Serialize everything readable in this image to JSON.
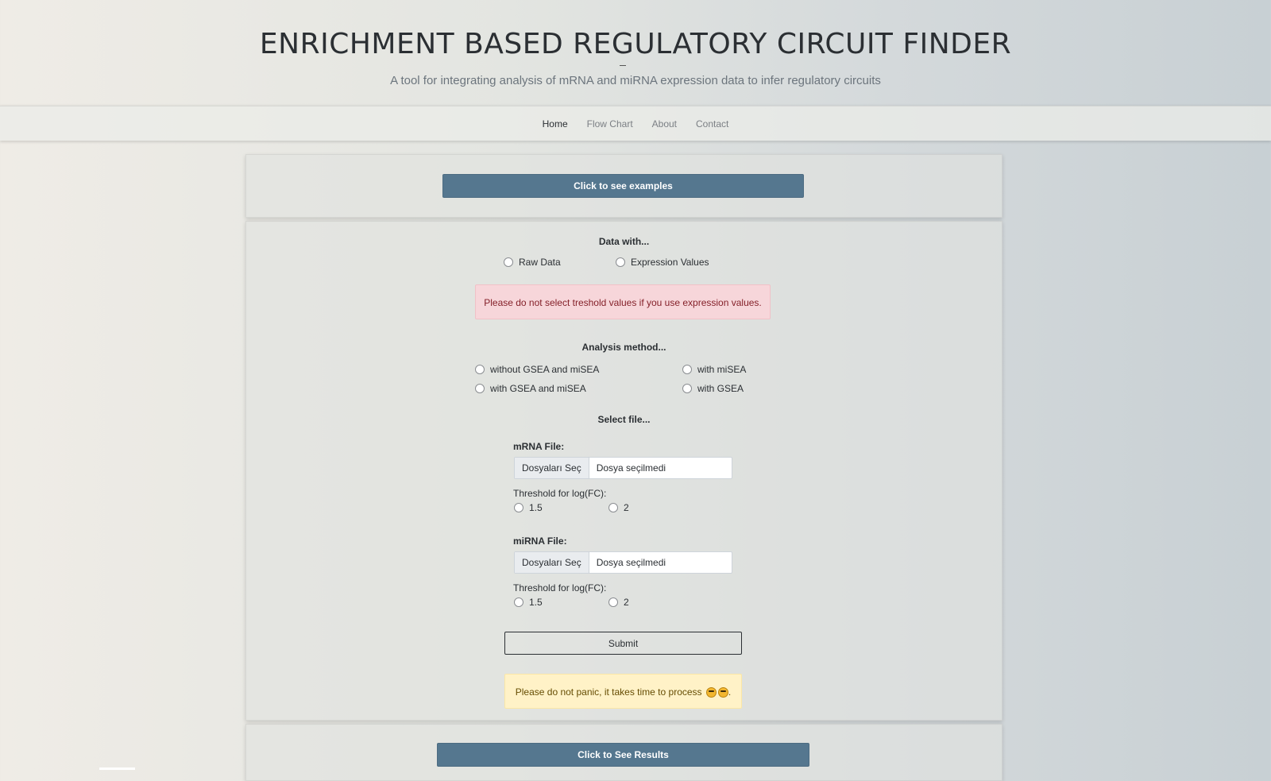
{
  "header": {
    "title": "ENRICHMENT BASED REGULATORY CIRCUIT FINDER",
    "subtitle": "A tool for integrating analysis of mRNA and miRNA expression data to infer regulatory circuits"
  },
  "nav": {
    "items": [
      {
        "label": "Home",
        "active": true
      },
      {
        "label": "Flow Chart",
        "active": false
      },
      {
        "label": "About",
        "active": false
      },
      {
        "label": "Contact",
        "active": false
      }
    ]
  },
  "examples": {
    "button_label": "Click to see examples"
  },
  "form": {
    "data_with": {
      "label": "Data with...",
      "options": [
        "Raw Data",
        "Expression Values"
      ]
    },
    "threshold_warning": "Please do not select treshold values if you use expression values.",
    "analysis": {
      "label": "Analysis method...",
      "options": [
        "without GSEA and miSEA",
        "with miSEA",
        "with GSEA and miSEA",
        "with GSEA"
      ]
    },
    "select_file_label": "Select file...",
    "mrna": {
      "label": "mRNA File:",
      "button": "Dosyaları Seç",
      "status": "Dosya seçilmedi",
      "threshold_label": "Threshold for log(FC):",
      "threshold_options": [
        "1.5",
        "2"
      ]
    },
    "mirna": {
      "label": "miRNA File:",
      "button": "Dosyaları Seç",
      "status": "Dosya seçilmedi",
      "threshold_label": "Threshold for log(FC):",
      "threshold_options": [
        "1.5",
        "2"
      ]
    },
    "submit_label": "Submit",
    "processing_note": "Please do not panic, it takes time to process",
    "processing_emojis": [
      "smiling-face-with-halo-icon",
      "nerd-face-icon"
    ]
  },
  "results": {
    "button_label": "Click to See Results"
  },
  "colors": {
    "primary_button": "#55778f",
    "danger_bg": "#f7d6da",
    "warning_bg": "#fff2c7"
  }
}
